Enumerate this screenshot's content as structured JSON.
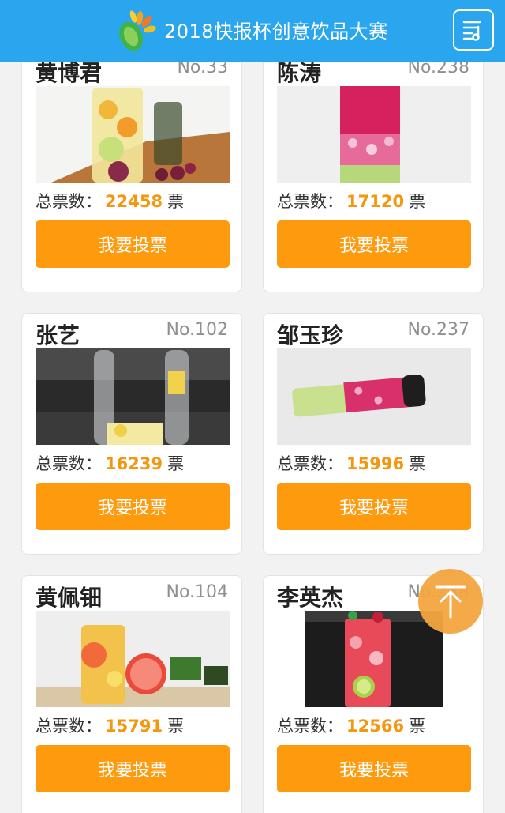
{
  "header": {
    "title": "2018快报杯创意饮品大赛",
    "logo_icon": "leaf-logo-icon",
    "menu_icon": "list-menu-icon"
  },
  "colors": {
    "header": "#2aa6ee",
    "vote_button": "#fe9a0e",
    "vote_count": "#f5960f",
    "back_to_top": "#f5a640"
  },
  "labels": {
    "votes_prefix": "总票数：",
    "votes_unit": "票",
    "vote_button": "我要投票"
  },
  "entries": [
    {
      "name": "黄博君",
      "number": "No.33",
      "votes": "22458"
    },
    {
      "name": "陈涛",
      "number": "No.238",
      "votes": "17120"
    },
    {
      "name": "张艺",
      "number": "No.102",
      "votes": "16239"
    },
    {
      "name": "邹玉珍",
      "number": "No.237",
      "votes": "15996"
    },
    {
      "name": "黄佩钿",
      "number": "No.104",
      "votes": "15791"
    },
    {
      "name": "李英杰",
      "number": "No.238",
      "votes": "12566"
    }
  ],
  "back_to_top_icon": "arrow-up-to-top-icon"
}
